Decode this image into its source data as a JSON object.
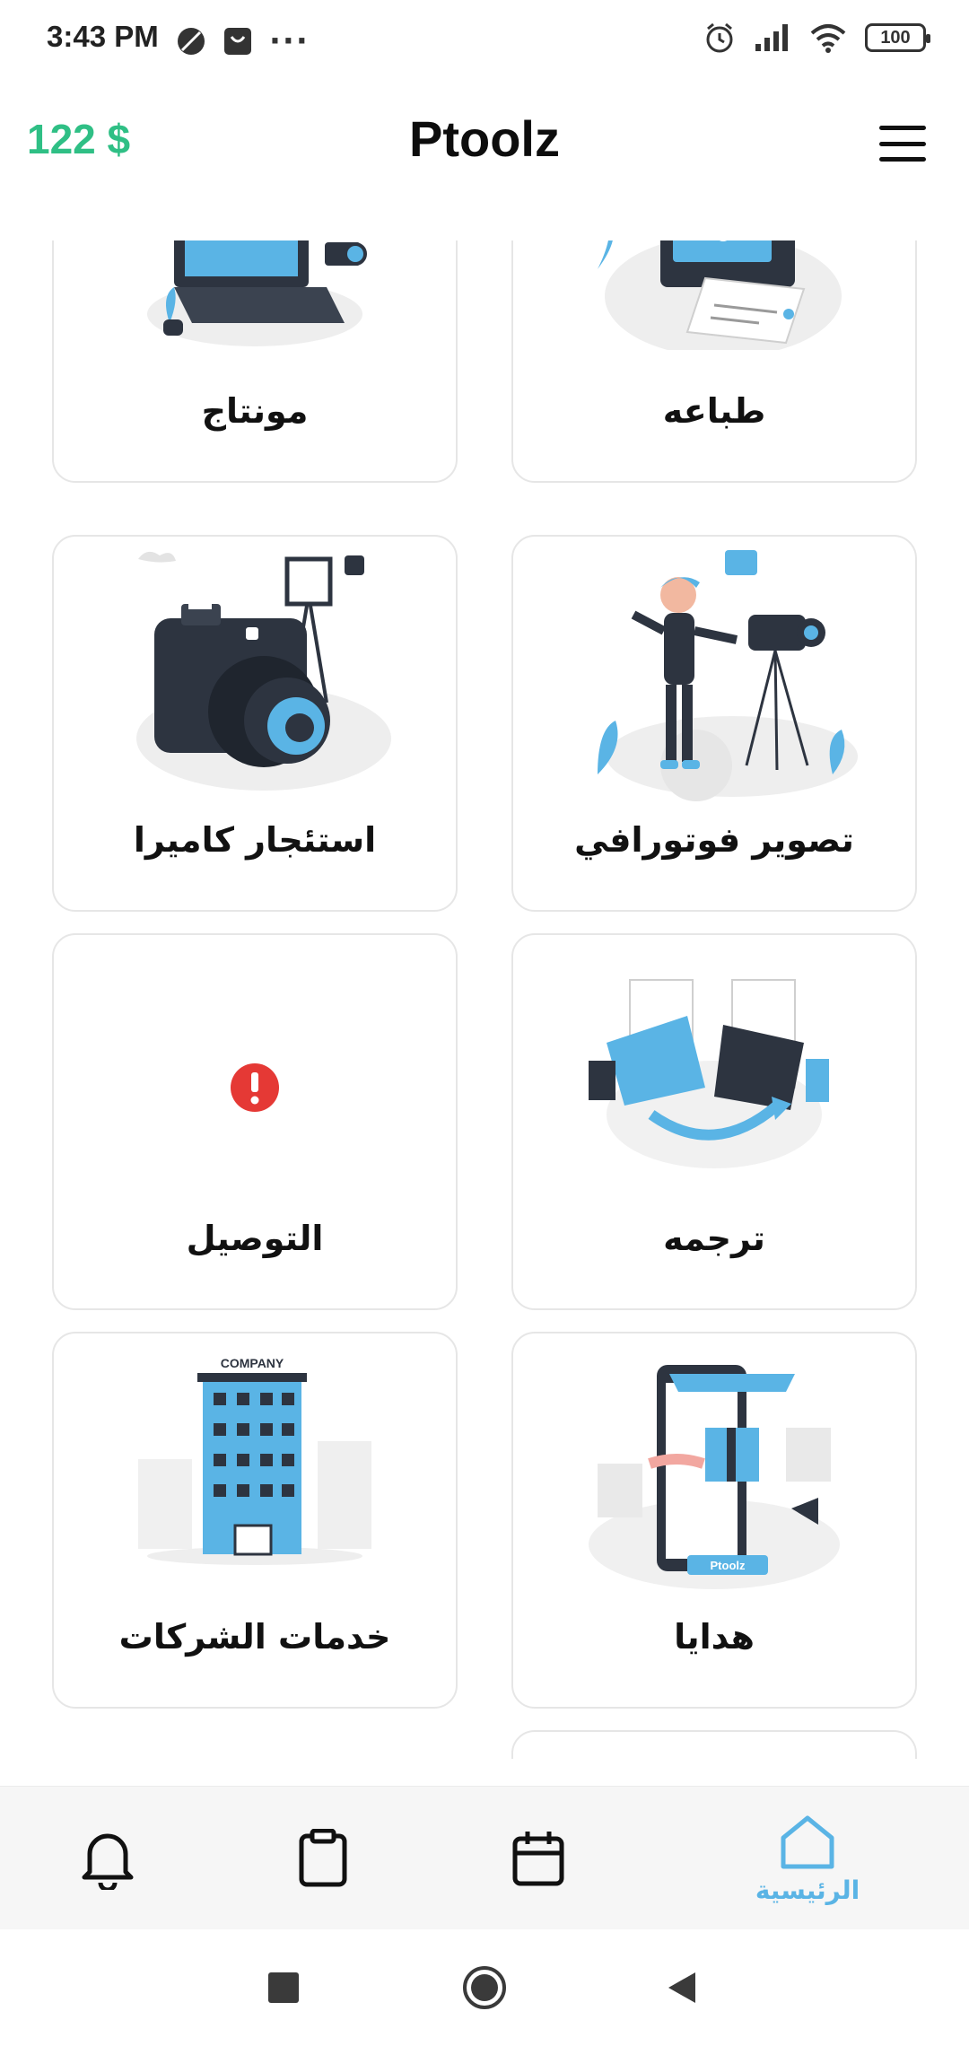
{
  "status_bar": {
    "time": "3:43 PM",
    "more": "···",
    "battery": "100"
  },
  "header": {
    "balance": "122 $",
    "title": "Ptoolz",
    "menu_icon": "hamburger-menu-icon"
  },
  "services": [
    {
      "label": "مونتاج",
      "icon": "video-editing-illustration"
    },
    {
      "label": "طباعه",
      "icon": "printer-illustration"
    },
    {
      "label": "استئجار كاميرا",
      "icon": "camera-rental-illustration"
    },
    {
      "label": "تصوير فوتورافي",
      "icon": "photographer-illustration"
    },
    {
      "label": "التوصيل",
      "icon": "error-icon"
    },
    {
      "label": "ترجمه",
      "icon": "translation-illustration"
    },
    {
      "label": "خدمات الشركات",
      "icon": "company-building-illustration",
      "sign": "COMPANY"
    },
    {
      "label": "هدايا",
      "icon": "gifts-illustration",
      "sign": "Ptoolz"
    }
  ],
  "bottom_nav": {
    "home_label": "الرئيسية",
    "items": [
      "bell-icon",
      "clipboard-icon",
      "calendar-icon",
      "home-icon"
    ]
  },
  "colors": {
    "balance": "#2fbf85",
    "accent": "#5ab4e5",
    "error": "#e53935"
  }
}
